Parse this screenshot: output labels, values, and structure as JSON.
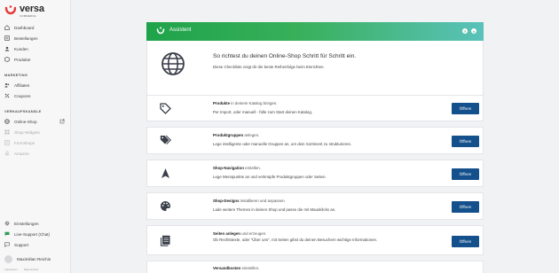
{
  "brand": {
    "name": "versa",
    "tagline": "COMMERCE"
  },
  "sidebar": {
    "top_items": [
      {
        "label": "Dashboard",
        "icon": "home-icon"
      },
      {
        "label": "Bestellungen",
        "icon": "orders-icon"
      },
      {
        "label": "Kunden",
        "icon": "customers-icon"
      },
      {
        "label": "Produkte",
        "icon": "products-icon"
      }
    ],
    "marketing_heading": "MARKETING",
    "marketing_items": [
      {
        "label": "Affiliates",
        "icon": "affiliates-icon"
      },
      {
        "label": "Coupons",
        "icon": "coupons-icon"
      }
    ],
    "channels_heading": "VERKAUFSKANÄLE",
    "channel_items": [
      {
        "label": "Online-Shop",
        "icon": "globe-icon"
      },
      {
        "label": "Shop-Widgets",
        "icon": "widget-icon"
      },
      {
        "label": "Formshops",
        "icon": "form-icon"
      },
      {
        "label": "Amazon",
        "icon": "amazon-icon"
      }
    ],
    "bottom_items": [
      {
        "label": "Einstellungen",
        "icon": "gear-icon"
      },
      {
        "label": "Live-Support (Chat)",
        "icon": "chat-icon"
      },
      {
        "label": "Support",
        "icon": "help-icon"
      }
    ],
    "user_name": "Maximilian Reichin",
    "footer_links": [
      "Impressum",
      "Datenschutz"
    ]
  },
  "assistant": {
    "header_title": "Assistent",
    "hero_title": "So richtest du deinen Online-Shop Schritt für Schritt ein.",
    "hero_text": "Diese Checkliste zeigt dir die beste Reihenfolge beim Einrichten."
  },
  "steps": [
    {
      "title": "Produkte",
      "title_suffix": "in deinem Katalog bringen.",
      "description": "Per Import, oder manuell - fülle zum Start deinen Katalog.",
      "button": "Öffnen",
      "icon": "tag-icon"
    },
    {
      "title": "Produktgruppen",
      "title_suffix": "anlegen.",
      "description": "Lege intelligente oder manuelle Gruppen an, um dein Sortiment zu strukturieren.",
      "button": "Öffnen",
      "icon": "tags-icon"
    },
    {
      "title": "Shop-Navigation",
      "title_suffix": "erstellen.",
      "description": "Lege Menüpunkte an und verknüpfe Produktgruppen oder Seiten.",
      "button": "Öffnen",
      "icon": "navigation-arrow-icon"
    },
    {
      "title": "Shop-Designs",
      "title_suffix": "installieren und anpassen.",
      "description": "Lade weitere Themes in deinen Shop und passe die mit Mausklicks an.",
      "button": "Öffnen",
      "icon": "palette-icon"
    },
    {
      "title": "Seiten anlegen",
      "title_suffix": "und erzeugen.",
      "description": "Ob Rechtstexte, oder \"Über uns\", mit Seiten gibst du deinen Besuchern wichtige Informationen.",
      "button": "Öffnen",
      "icon": "pages-icon"
    },
    {
      "title": "Versandkosten",
      "title_suffix": "einstellen.",
      "description": "",
      "button": "",
      "icon": "shipping-icon"
    }
  ]
}
